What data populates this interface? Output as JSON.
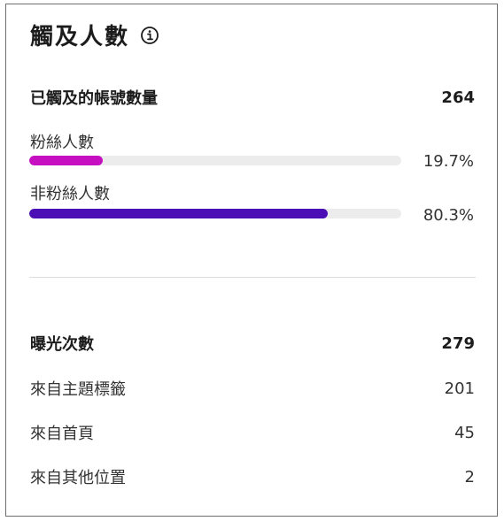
{
  "card": {
    "title": "觸及人數",
    "info_icon": "info-icon"
  },
  "reach": {
    "label": "已觸及的帳號數量",
    "value": "264",
    "breakdown": [
      {
        "label": "粉絲人數",
        "percent_text": "19.7%",
        "fraction": 0.197,
        "color": "#c70fc2"
      },
      {
        "label": "非粉絲人數",
        "percent_text": "80.3%",
        "fraction": 0.803,
        "color": "#4b0fb5"
      }
    ],
    "track_color": "#ececec"
  },
  "impressions": {
    "label": "曝光次數",
    "value": "279",
    "sources": [
      {
        "label": "來自主題標籤",
        "value": "201"
      },
      {
        "label": "來自首頁",
        "value": "45"
      },
      {
        "label": "來自其他位置",
        "value": "2"
      }
    ]
  }
}
